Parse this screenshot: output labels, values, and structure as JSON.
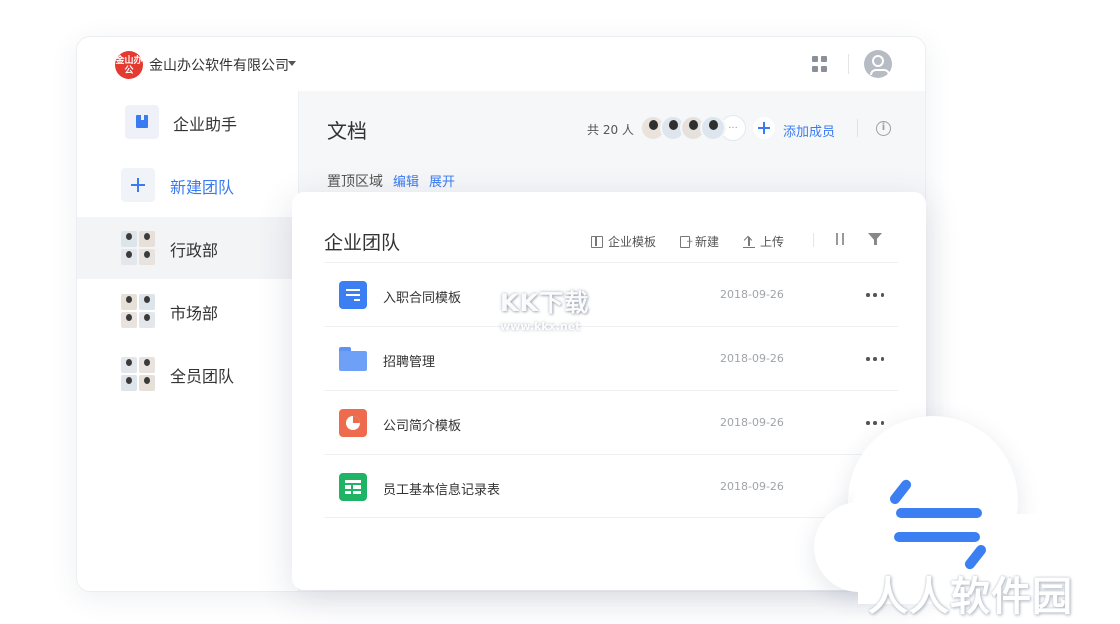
{
  "header": {
    "org_logo_text": "金山办公",
    "org_name": "金山办公软件有限公司",
    "apps_icon": "grid-icon",
    "avatar_icon": "user-avatar-icon"
  },
  "sidebar": {
    "items": [
      {
        "label": "企业助手",
        "icon": "assistant-icon"
      },
      {
        "label": "新建团队",
        "icon": "plus-icon"
      },
      {
        "label": "行政部",
        "icon": "team-avatars-icon"
      },
      {
        "label": "市场部",
        "icon": "team-avatars-icon"
      },
      {
        "label": "全员团队",
        "icon": "team-avatars-icon"
      }
    ]
  },
  "docs": {
    "title": "文档",
    "member_count": "共 20 人",
    "more_members": "···",
    "add_member": "添加成员",
    "info_icon_text": "i",
    "pinned_label": "置顶区域",
    "pinned_edit": "编辑",
    "pinned_expand": "展开"
  },
  "card": {
    "title": "企业团队",
    "toolbar": {
      "template": "企业模板",
      "new": "新建",
      "upload": "上传"
    },
    "files": [
      {
        "name": "入职合同模板",
        "date": "2018-09-26",
        "type": "doc"
      },
      {
        "name": "招聘管理",
        "date": "2018-09-26",
        "type": "folder"
      },
      {
        "name": "公司简介模板",
        "date": "2018-09-26",
        "type": "presentation"
      },
      {
        "name": "员工基本信息记录表",
        "date": "2018-09-26",
        "type": "spreadsheet"
      }
    ]
  },
  "watermark": {
    "main": "KK下载",
    "sub": "www.kkx.net"
  },
  "brand": "人人软件园",
  "colors": {
    "accent": "#3a7bf2",
    "logo_red": "#e43a30",
    "doc_blue": "#3b7ff3",
    "ppt_orange": "#ee6c4d",
    "sheet_green": "#1fb366"
  }
}
